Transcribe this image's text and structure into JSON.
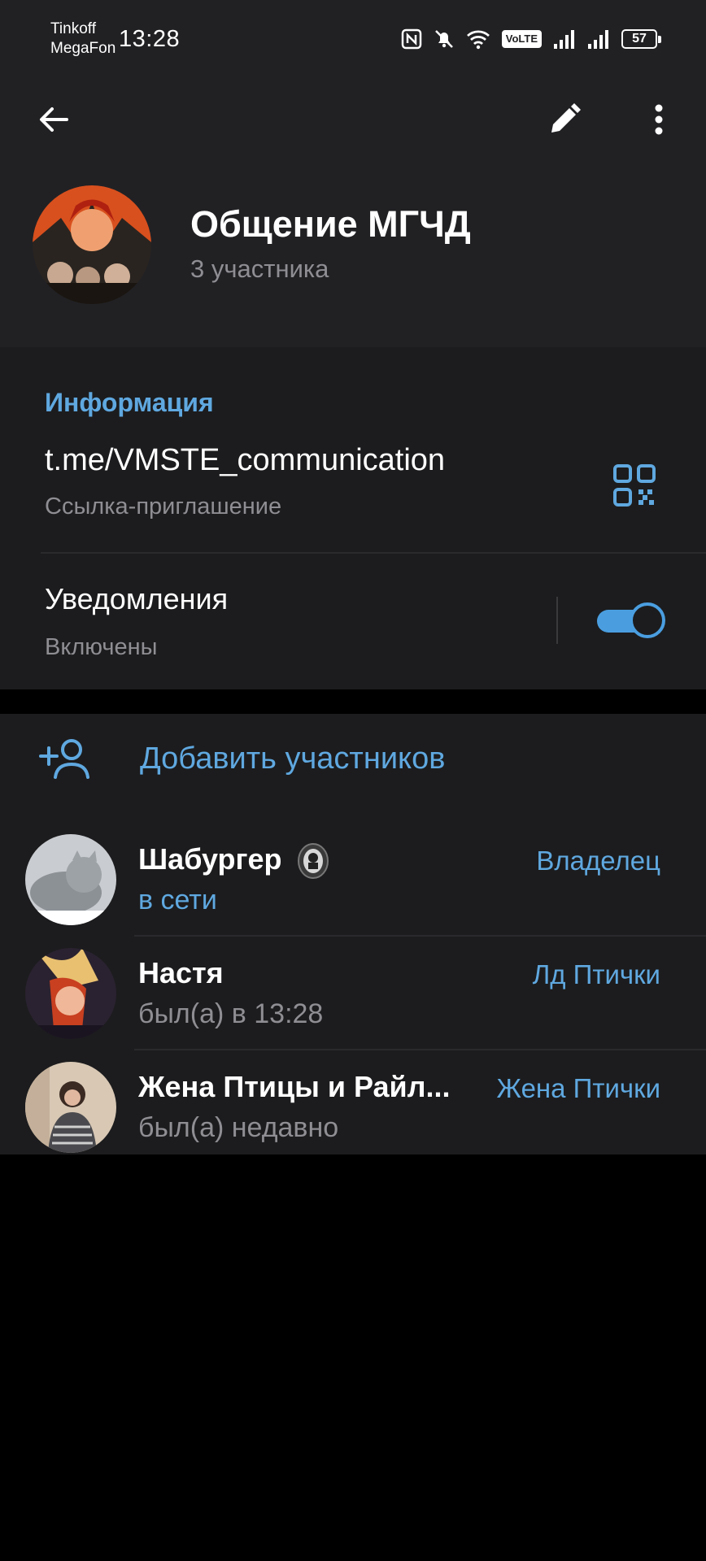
{
  "status_bar": {
    "carrier_1": "Tinkoff",
    "carrier_2": "MegaFon",
    "time": "13:28",
    "volte": "VoLTE",
    "battery": "57",
    "icons": [
      "nfc-icon",
      "mute-icon",
      "wifi-icon",
      "volte-icon",
      "signal-icon",
      "signal-icon",
      "battery-icon"
    ]
  },
  "header": {
    "back_icon": "arrow-left-icon",
    "edit_icon": "pencil-icon",
    "more_icon": "more-vertical-icon",
    "title": "Общение МГЧД",
    "subtitle": "3 участника"
  },
  "info": {
    "section_title": "Информация",
    "link": "t.me/VMSTE_communication",
    "link_label": "Ссылка-приглашение",
    "qr_icon": "qr-code-icon",
    "notifications_title": "Уведомления",
    "notifications_status": "Включены",
    "notifications_on": true
  },
  "members": {
    "add_label": "Добавить участников",
    "add_icon": "add-user-icon",
    "list": [
      {
        "name": "Шабургер",
        "status": "в сети",
        "role": "Владелец",
        "online": true
      },
      {
        "name": "Настя",
        "status": "был(а) в 13:28",
        "role": "Лд Птички",
        "online": false
      },
      {
        "name": "Жена Птицы и Райл...",
        "status": "был(а) недавно",
        "role": "Жена Птички",
        "online": false
      }
    ]
  },
  "colors": {
    "accent": "#5fa8e0",
    "surface": "#1c1c1e",
    "header": "#212124",
    "secondary_text": "#8e8e93"
  }
}
